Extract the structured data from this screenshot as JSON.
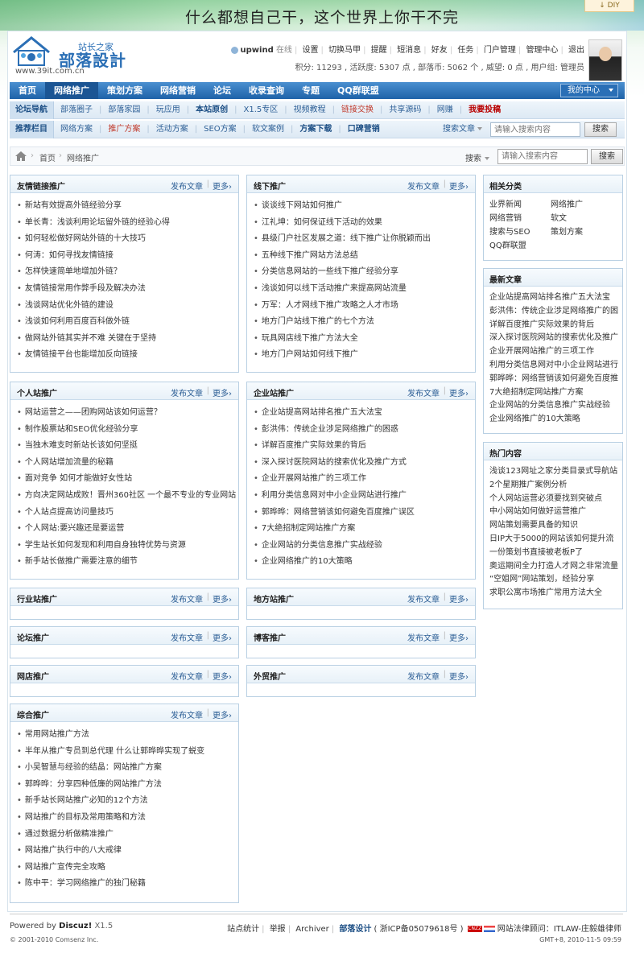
{
  "banner": {
    "slogan": "什么都想自己干，这个世界上你干不完",
    "diy_label": "DIY"
  },
  "logo": {
    "title_small": "站长之家",
    "title_large": "部落設計",
    "url": "www.39it.com.cn"
  },
  "userbar": {
    "username": "upwind",
    "status": "在线",
    "links": [
      "设置",
      "切换马甲",
      "提醒",
      "短消息",
      "好友",
      "任务",
      "门户管理",
      "管理中心",
      "退出"
    ],
    "stats": "积分: 11293 , 活跃度: 5307 点 , 部落币: 5062 个 , 威望: 0 点 , 用户组: 管理员"
  },
  "main_nav": {
    "items": [
      "首页",
      "网络推广",
      "策划方案",
      "网络营销",
      "论坛",
      "收录查询",
      "专题",
      "QQ群联盟"
    ],
    "active_index": 1,
    "my_center": "我的中心"
  },
  "subnav1": {
    "head": "论坛导航",
    "items": [
      {
        "label": "部落圈子",
        "style": ""
      },
      {
        "label": "部落家园",
        "style": ""
      },
      {
        "label": "玩应用",
        "style": ""
      },
      {
        "label": "本站原创",
        "style": "b"
      },
      {
        "label": "X1.5专区",
        "style": ""
      },
      {
        "label": "视频教程",
        "style": ""
      },
      {
        "label": "链接交换",
        "style": "red"
      },
      {
        "label": "共享源码",
        "style": ""
      },
      {
        "label": "网赚",
        "style": ""
      },
      {
        "label": "我要投稿",
        "style": "dred"
      }
    ]
  },
  "subnav2": {
    "head": "推荐栏目",
    "items": [
      {
        "label": "网络方案",
        "style": ""
      },
      {
        "label": "推广方案",
        "style": "red"
      },
      {
        "label": "活动方案",
        "style": ""
      },
      {
        "label": "SEO方案",
        "style": ""
      },
      {
        "label": "软文案例",
        "style": ""
      },
      {
        "label": "方案下载",
        "style": "b"
      },
      {
        "label": "口碑营销",
        "style": "b"
      }
    ],
    "search_label": "搜索文章",
    "search_placeholder": "请输入搜索内容",
    "search_button": "搜索"
  },
  "breadcrumb": {
    "home": "首页",
    "current": "网络推广",
    "search_label": "搜索",
    "search_placeholder": "请输入搜索内容",
    "search_button": "搜索"
  },
  "box_actions": {
    "publish": "发布文章",
    "more": "更多›"
  },
  "boxes": {
    "friendlinks": {
      "title": "友情链接推广",
      "items": [
        "新站有效提高外链经验分享",
        "单长青：浅谈利用论坛留外链的经验心得",
        "如何轻松做好网站外链的十大技巧",
        "何涛：如何寻找友情链接",
        "怎样快速简单地增加外链？",
        "友情链接常用作弊手段及解决办法",
        "浅谈网站优化外链的建设",
        "浅谈如何利用百度百科做外链",
        "做网站外链其实并不难 关键在于坚持",
        "友情链接平台也能增加反向链接"
      ]
    },
    "offline": {
      "title": "线下推广",
      "items": [
        "谈谈线下网站如何推广",
        "江礼坤：如何保证线下活动的效果",
        "县级门户社区发展之道：线下推广让你脱颖而出",
        "五种线下推广网站方法总结",
        "分类信息网站的一些线下推广经验分享",
        "浅谈如何以线下活动推广来提高网站流量",
        "万军：人才网线下推广攻略之人才市场",
        "地方门户站线下推广的七个方法",
        "玩具网店线下推广方法大全",
        "地方门户网站如何线下推广"
      ]
    },
    "personal": {
      "title": "个人站推广",
      "items": [
        "网站运营之——团购网站该如何运营？",
        "制作股票站和SEO优化经验分享",
        "当独木难支时新站长该如何坚挺",
        "个人网站增加流量的秘籍",
        "面对竞争 如何才能做好女性站",
        "方向决定网站成败！晋州360社区 一个最不专业的专业网站",
        "个人站点提高访问量技巧",
        "个人网站:要兴趣还是要运营",
        "学生站长如何发现和利用自身独特优势与资源",
        "新手站长做推广需要注意的细节"
      ]
    },
    "enterprise": {
      "title": "企业站推广",
      "items": [
        "企业站提高网站排名推广五大法宝",
        "彭洪伟：传统企业涉足网络推广的困惑",
        "详解百度推广实际效果的背后",
        "深入探讨医院网站的搜索优化及推广方式",
        "企业开展网站推广的三项工作",
        "利用分类信息网对中小企业网站进行推广",
        "郭晔晔：网络营销该如何避免百度推广误区",
        "7大绝招制定网站推广方案",
        "企业网站的分类信息推广实战经验",
        "企业网络推广的10大策略"
      ]
    },
    "industry": {
      "title": "行业站推广"
    },
    "local": {
      "title": "地方站推广"
    },
    "forum": {
      "title": "论坛推广"
    },
    "blog": {
      "title": "博客推广"
    },
    "shop": {
      "title": "网店推广"
    },
    "foreign": {
      "title": "外贸推广"
    },
    "general": {
      "title": "综合推广",
      "items": [
        "常用网站推广方法",
        "半年从推广专员到总代理 什么让郭晔晔实现了蜕变",
        "小吴智慧与经验的结晶：网站推广方案",
        "郭晔晔：分享四种低廉的网站推广方法",
        "新手站长网站推广必知的12个方法",
        "网站推广的目标及常用策略和方法",
        "通过数据分析做精准推广",
        "网站推广执行中的八大戒律",
        "网站推广宣传完全攻略",
        "陈中平：学习网络推广的独门秘籍"
      ]
    }
  },
  "sidebar": {
    "categories": {
      "title": "相关分类",
      "items": [
        "业界新闻",
        "网络推广",
        "网络营销",
        "软文",
        "搜索与SEO",
        "策划方案",
        "QQ群联盟"
      ]
    },
    "latest": {
      "title": "最新文章",
      "items": [
        "企业站提高网站排名推广五大法宝",
        "彭洪伟：传统企业涉足网络推广的困",
        "详解百度推广实际效果的背后",
        "深入探讨医院网站的搜索优化及推广",
        "企业开展网站推广的三项工作",
        "利用分类信息网对中小企业网站进行",
        "郭晔晔：网络营销该如何避免百度推",
        "7大绝招制定网站推广方案",
        "企业网站的分类信息推广实战经验",
        "企业网络推广的10大策略"
      ]
    },
    "hot": {
      "title": "热门内容",
      "items": [
        "浅谈123网址之家分类目录式导航站",
        "2个星期推广案例分析",
        "个人网站运营必须要找到突破点",
        "中小网站如何做好运营推广",
        "网站策划需要具备的知识",
        "日IP大于5000的网站该如何提升流",
        "一份策划书直接被老板P了",
        "奥运期间全力打造人才网之非常流量",
        "“空姐网”网站策划，经验分享",
        "求职公寓市场推广常用方法大全"
      ]
    }
  },
  "footer": {
    "powered_by": "Powered by",
    "product": "Discuz!",
    "version": "X1.5",
    "links": [
      "站点统计",
      "举报",
      "Archiver"
    ],
    "site_name": "部落设计",
    "icp": "( 浙ICP备05079618号 )",
    "cnzz": "CNZZ",
    "legal": "网站法律顾问：ITLAW-庄毅雄律师",
    "copyright": "© 2001-2010 Comsenz Inc.",
    "time": "GMT+8, 2010-11-5 09:59"
  },
  "colors": {
    "nav_blue": "#1e62a8",
    "link_blue": "#2d5f96",
    "highlight_red": "#c0392b",
    "border_blue": "#b9d0e3"
  }
}
